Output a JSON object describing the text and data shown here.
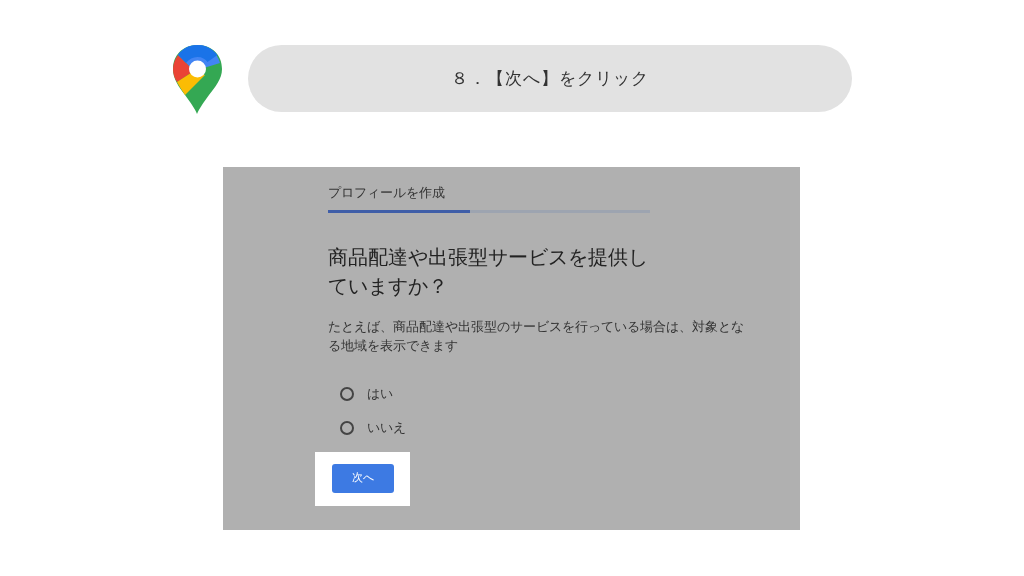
{
  "step_banner": {
    "text": "８．【次へ】をクリック"
  },
  "screenshot": {
    "header": "プロフィールを作成",
    "progress": {
      "level": 0.44
    },
    "title": "商品配達や出張型サービスを提供していますか？",
    "description": "たとえば、商品配達や出張型のサービスを行っている場合は、対象となる地域を表示できます",
    "options": [
      {
        "label": "はい",
        "selected": false
      },
      {
        "label": "いいえ",
        "selected": false
      }
    ],
    "next_button": {
      "label": "次へ",
      "highlighted": true
    }
  }
}
